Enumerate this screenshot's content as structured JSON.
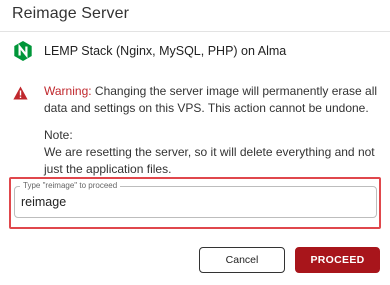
{
  "dialog": {
    "title": "Reimage Server"
  },
  "app": {
    "name": "LEMP Stack (Nginx, MySQL, PHP) on Alma",
    "icon": "nginx-logo-icon",
    "brand_color": "#009639"
  },
  "warning": {
    "icon": "warning-triangle-icon",
    "label": "Warning:",
    "text": " Changing the server image will permanently erase all data and settings on this VPS. This action cannot be undone.",
    "color": "#c0282d"
  },
  "note": {
    "label": "Note:",
    "text": "We are resetting the server, so it will delete everything and not just the application files."
  },
  "confirm_field": {
    "label": "Type \"reimage\" to proceed",
    "value": "reimage"
  },
  "buttons": {
    "cancel": "Cancel",
    "proceed": "PROCEED",
    "proceed_color": "#a8151b"
  }
}
